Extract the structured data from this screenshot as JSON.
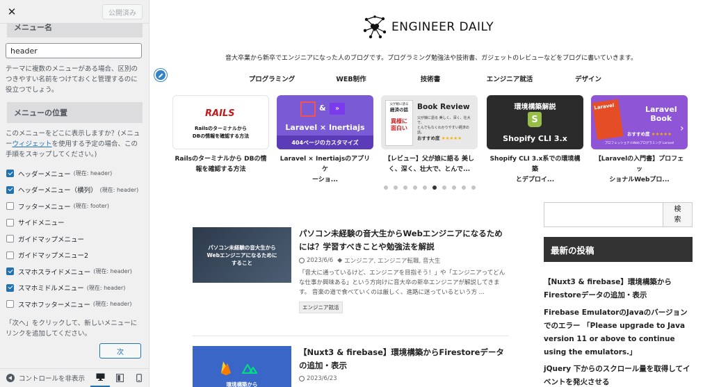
{
  "sidebar": {
    "close_label": "✕",
    "publish_label": "公開済み",
    "menu_name_heading": "メニュー名",
    "menu_name_value": "header",
    "menu_name_help": "テーマに複数のメニューがある場合、区別のつきやすい名前をつけておくと管理するのに役立つでしょう。",
    "location_heading": "メニューの位置",
    "location_help_before": "このメニューをどこに表示しますか？(メニュー",
    "location_help_link": "ウィジェット",
    "location_help_after": "を使用する予定の場合、この手順をスキップしてください。)",
    "locations": [
      {
        "label": "ヘッダーメニュー",
        "note": "(現在: header)",
        "checked": true
      },
      {
        "label": "ヘッダーメニュー（横列）",
        "note": "(現在: header)",
        "checked": true
      },
      {
        "label": "フッターメニュー",
        "note": "(現在: footer)",
        "checked": false
      },
      {
        "label": "サイドメニュー",
        "note": "",
        "checked": false
      },
      {
        "label": "ガイドマップメニュー",
        "note": "",
        "checked": false
      },
      {
        "label": "ガイドマップメニュー2",
        "note": "",
        "checked": false
      },
      {
        "label": "スマホスライドメニュー",
        "note": "(現在: header)",
        "checked": true
      },
      {
        "label": "スマホミドルメニュー",
        "note": "(現在: header)",
        "checked": true
      },
      {
        "label": "スマホフッターメニュー",
        "note": "(現在: header)",
        "checked": false
      }
    ],
    "next_help": "「次へ」をクリックして、新しいメニューにリンクを追加してください。",
    "next_label": "次",
    "hide_controls_label": "コントロールを非表示"
  },
  "preview": {
    "site_name": "ENGINEER DAILY",
    "tagline": "音大卒業から新卒でエンジニアになった人のブログです。プログラミング勉強法や技術書、ガジェットのレビューなどをブログに書いていきます。",
    "nav": [
      "プログラミング",
      "WEB制作",
      "技術書",
      "エンジニア就活",
      "デザイン"
    ],
    "slides": [
      {
        "img_line1": "Railsのターミナルから",
        "img_line2": "DBの情報を確認する方法",
        "brand": "RAILS",
        "cap1": "Railsのターミナルから DBの情",
        "cap2": "報を確認する方法"
      },
      {
        "img_title": "Laravel × Inertiajs",
        "img_sub": "404ページのカスタマイズ",
        "amp": "&",
        "cap1": "Laravel × Inertiajsのアプリケ",
        "cap2": "ーショ..."
      },
      {
        "img_title": "Book Review",
        "img_sub1": "父が娘に語る 美しく、深く、壮大で、",
        "img_sub2": "とんでもなくわかりやすい経済の話。",
        "book_l1": "父が娘に語る",
        "book_l2": "経済の話",
        "book_big1": "異様に",
        "book_big2": "面白い",
        "rating_label": "おすすめ度",
        "stars": "★★★★★",
        "cap1": "【レビュー】父が娘に語る 美し",
        "cap2": "く、深く、壮大で、とんで..."
      },
      {
        "img_title": "環境構築解説",
        "img_sub": "Shopify CLI 3.x",
        "cap1": "Shopify CLI 3.x系での環境構築",
        "cap2": "とデプロイ..."
      },
      {
        "img_title1": "Laravel",
        "img_title2": "Book",
        "book_name": "Laravel",
        "rating_label": "おすすめ度",
        "stars": "★★★★★",
        "img_sub": "プロフェッショナルWebプログラミング Laravel",
        "cap1": "【Laravelの入門書】プロフェッ",
        "cap2": "ショナルWebプロ..."
      }
    ],
    "slider_arrow": "›",
    "dots_total": 10,
    "dots_active": 5,
    "posts": [
      {
        "thumb_text1": "パソコン未経験の音大生から",
        "thumb_text2": "Webエンジニアになるために",
        "thumb_text3": "すること",
        "title": "パソコン未経験の音大生からWebエンジニアになるためには？学習すべきことや勉強法を解説",
        "date": "2023/6/6",
        "tags": "エンジニア, エンジニア転職, 音大生",
        "tag_icon": "◆",
        "excerpt": "「音大に通っているけど、エンジニアを目指そう！」や「エンジニアってどんな仕事か興味ある」という方向けに音大卒の新卒エンジニアが解説してきます。 音楽の道で食べていくのは厳しく、進路に迷っているという方 ...",
        "category": "エンジニア就活"
      },
      {
        "thumb_text": "環境構築から",
        "title": "【Nuxt3 & firebase】環境構築からFirestoreデータの追加・表示",
        "date": "2023/6/23"
      }
    ],
    "search_button": "検索",
    "widget_title": "最新の投稿",
    "recent_posts": [
      "【Nuxt3 & firebase】環境構築からFirestoreデータの追加・表示",
      "Firebase EmulatorのJavaのバージョンでのエラー 「Please upgrade to Java version 11 or above to continue using the emulators.」",
      "jQuery 下からのスクロール量を取得してイベントを発火させる"
    ]
  }
}
